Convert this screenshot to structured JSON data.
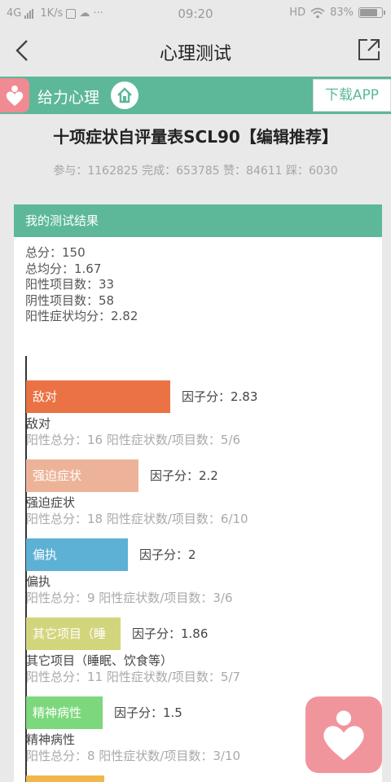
{
  "status_bar": {
    "network": "4G",
    "speed": "1K/s",
    "time": "09:20",
    "hd": "HD",
    "battery_text": "83%",
    "battery_level": 0.83
  },
  "nav": {
    "title": "心理测试",
    "back_icon": "chevron-left-icon",
    "share_icon": "share-icon"
  },
  "brand": {
    "name": "给力心理",
    "download_label": "下载APP"
  },
  "test": {
    "title": "十项症状自评量表SCL90【编辑推荐】",
    "stats": "参与：1162825 完成：653785 赞：84611 踩：6030"
  },
  "result": {
    "header": "我的测试结果",
    "summary": [
      "总分：150",
      "总均分：1.67",
      "阳性项目数：33",
      "阴性项目数：58",
      "阳性症状均分：2.82"
    ]
  },
  "chart_data": {
    "type": "bar",
    "orientation": "horizontal",
    "categories": [
      "敌对",
      "强迫症状",
      "偏执",
      "其它项目（睡眠、饮食等）",
      "精神病性"
    ],
    "values": [
      2.83,
      2.2,
      2,
      1.86,
      1.5
    ],
    "factors": [
      {
        "bar_label": "敌对",
        "score": "因子分：2.83",
        "value": 2.83,
        "name": "敌对",
        "detail": "阳性总分：16    阳性症状数/项目数：5/6",
        "color": "#ea7244"
      },
      {
        "bar_label": "强迫症状",
        "score": "因子分：2.2",
        "value": 2.2,
        "name": "强迫症状",
        "detail": "阳性总分：18    阳性症状数/项目数：6/10",
        "color": "#edb399"
      },
      {
        "bar_label": "偏执",
        "score": "因子分：2",
        "value": 2,
        "name": "偏执",
        "detail": "阳性总分：9    阳性症状数/项目数：3/6",
        "color": "#5cb1d5"
      },
      {
        "bar_label": "其它项目（睡",
        "score": "因子分：1.86",
        "value": 1.86,
        "name": "其它项目（睡眠、饮食等）",
        "detail": "阳性总分：11    阳性症状数/项目数：5/7",
        "color": "#d3d57d"
      },
      {
        "bar_label": "精神病性",
        "score": "因子分：1.5",
        "value": 1.5,
        "name": "精神病性",
        "detail": "阳性总分：8    阳性症状数/项目数：3/10",
        "color": "#7cd87c"
      }
    ],
    "next_bar_color": "#f1b64c"
  },
  "colors": {
    "brand_green": "#5cb898",
    "brand_pink": "#f08a93"
  }
}
